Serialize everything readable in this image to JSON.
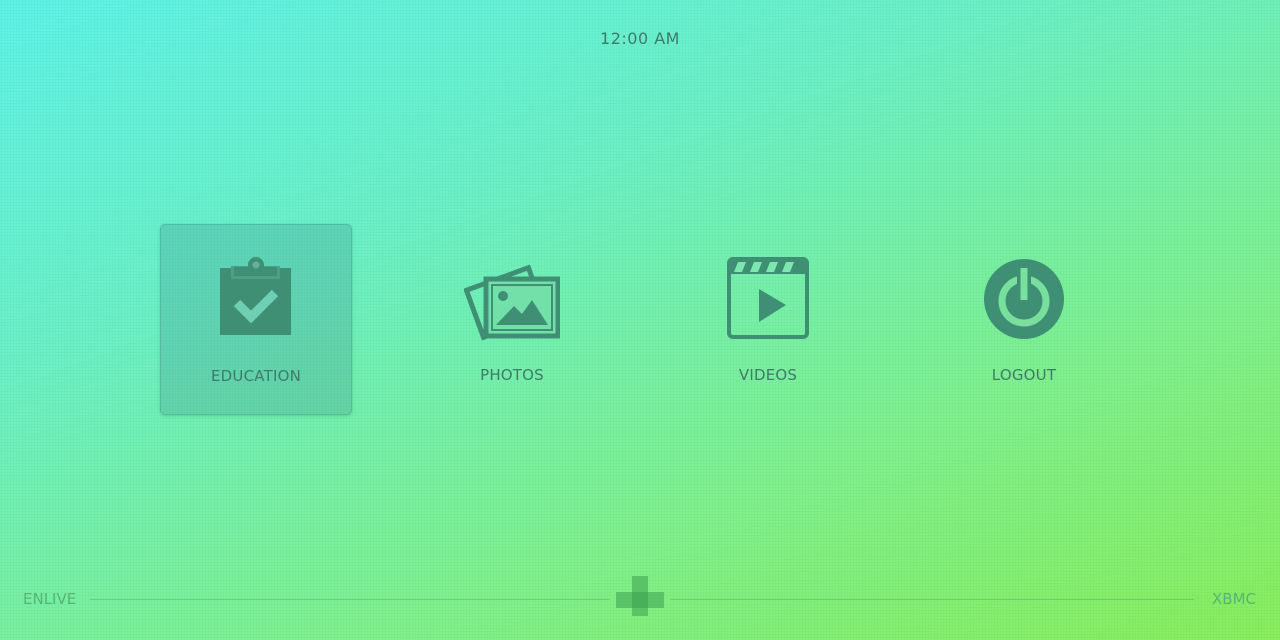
{
  "clock": {
    "time": "12:00 AM"
  },
  "menu": {
    "items": [
      {
        "label": "EDUCATION",
        "icon": "clipboard-check-icon",
        "focused": true
      },
      {
        "label": "PHOTOS",
        "icon": "photos-icon",
        "focused": false
      },
      {
        "label": "VIDEOS",
        "icon": "clapperboard-icon",
        "focused": false
      },
      {
        "label": "LOGOUT",
        "icon": "power-icon",
        "focused": false
      }
    ]
  },
  "footer": {
    "left_text": "ENLIVE",
    "right_text": "XBMC",
    "logo_icon": "plus-logo-icon"
  },
  "colors": {
    "icon": "#3f8f74",
    "label": "#3f7a6a",
    "focus_bg": "#4a9c8e"
  }
}
